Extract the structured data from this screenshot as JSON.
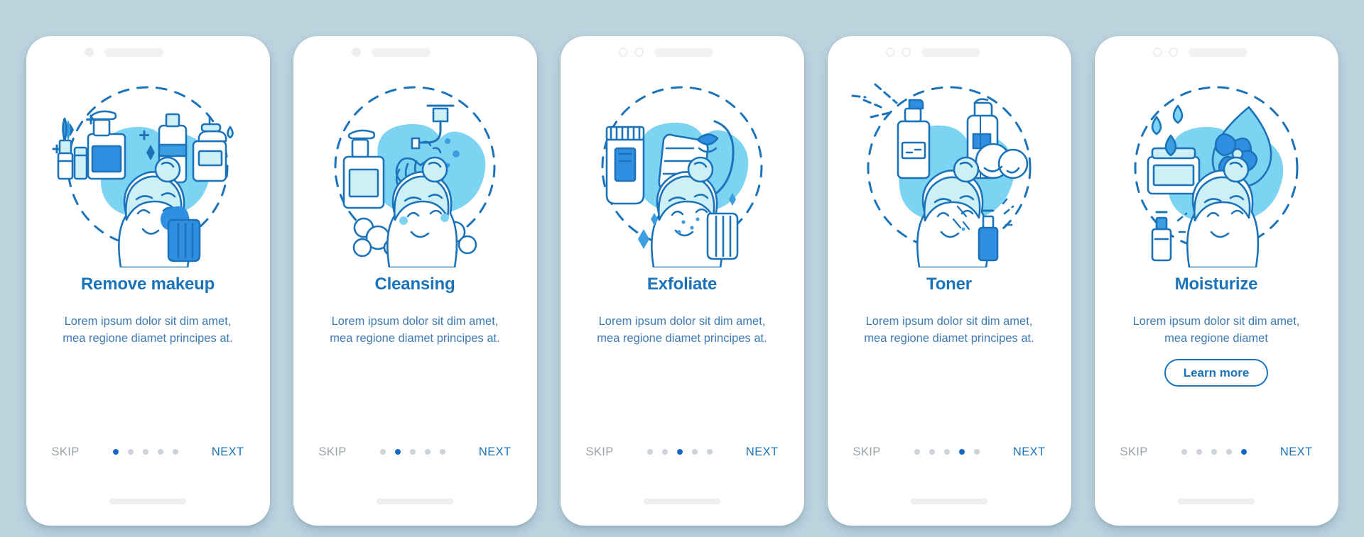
{
  "colors": {
    "background": "#bdd3de",
    "card": "#ffffff",
    "title": "#1b73ba",
    "body_text": "#3c7ab4",
    "skip": "#9aa3ab",
    "next": "#1b73ba",
    "dot_active": "#1668c4",
    "dot_inactive": "#cdd3d8",
    "blob": "#7dd3f2",
    "line_dark": "#1b73ba",
    "line_mid": "#3b9ee0",
    "fill_light": "#cdf0f7",
    "fill_blue": "#2f8fe0",
    "notch_gray": "#eceef0"
  },
  "common": {
    "skip_label": "SKIP",
    "next_label": "NEXT",
    "dots_total": 5
  },
  "screens": [
    {
      "id": "remove-makeup",
      "title": "Remove makeup",
      "body": "Lorem ipsum dolor sit dim amet, mea regione diamet principes at.",
      "active_dot": 1,
      "notch_style": "single-dot",
      "has_learn_more": false,
      "learn_more_label": "",
      "illustration": "makeup-products-and-woman-with-cotton-pad"
    },
    {
      "id": "cleansing",
      "title": "Cleansing",
      "body": "Lorem ipsum dolor sit dim amet, mea regione diamet principes at.",
      "active_dot": 2,
      "notch_style": "single-dot",
      "has_learn_more": false,
      "learn_more_label": "",
      "illustration": "faucet-soap-dispenser-washing-hands-and-woman-with-foam"
    },
    {
      "id": "exfoliate",
      "title": "Exfoliate",
      "body": "Lorem ipsum dolor sit dim amet, mea regione diamet principes at.",
      "active_dot": 3,
      "notch_style": "double-ring",
      "has_learn_more": false,
      "learn_more_label": "",
      "illustration": "scrub-tube-hand-with-scrub-and-woman-exfoliating"
    },
    {
      "id": "toner",
      "title": "Toner",
      "body": "Lorem ipsum dolor sit dim amet, mea regione diamet principes at.",
      "active_dot": 4,
      "notch_style": "double-ring",
      "has_learn_more": false,
      "learn_more_label": "",
      "illustration": "toner-spray-bottle-cotton-pads-and-woman-applying-toner"
    },
    {
      "id": "moisturize",
      "title": "Moisturize",
      "body": "Lorem ipsum dolor sit dim amet, mea regione diamet",
      "active_dot": 5,
      "notch_style": "double-ring",
      "has_learn_more": true,
      "learn_more_label": "Learn more",
      "illustration": "cream-jar-water-drop-flower-and-woman-moisturizing"
    }
  ]
}
